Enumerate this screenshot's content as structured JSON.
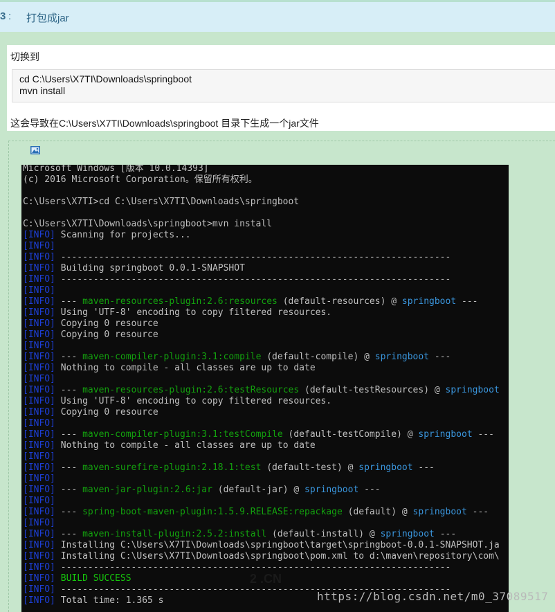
{
  "header": {
    "step_number": "3",
    "separator": ":",
    "title": "打包成jar"
  },
  "content": {
    "intro": "切换到",
    "code_lines": [
      "cd C:\\Users\\X7TI\\Downloads\\springboot",
      "mvn install"
    ],
    "result": "这会导致在C:\\Users\\X7TI\\Downloads\\springboot 目录下生成一个jar文件"
  },
  "editor": {
    "image_icon": "image-icon"
  },
  "terminal": {
    "lines": [
      [
        {
          "t": "Microsoft Windows [版本 10.0.14393]"
        }
      ],
      [
        {
          "t": "(c) 2016 Microsoft Corporation。保留所有权利。"
        }
      ],
      [],
      [
        {
          "t": "C:\\Users\\X7TI>cd C:\\Users\\X7TI\\Downloads\\springboot"
        }
      ],
      [],
      [
        {
          "t": "C:\\Users\\X7TI\\Downloads\\springboot>mvn install"
        }
      ],
      [
        {
          "t": "[INFO]",
          "c": "info"
        },
        {
          "t": " Scanning for projects..."
        }
      ],
      [
        {
          "t": "[INFO]",
          "c": "info"
        }
      ],
      [
        {
          "t": "[INFO]",
          "c": "info"
        },
        {
          "t": " ------------------------------------------------------------------------"
        }
      ],
      [
        {
          "t": "[INFO]",
          "c": "info"
        },
        {
          "t": " Building springboot 0.0.1-SNAPSHOT"
        }
      ],
      [
        {
          "t": "[INFO]",
          "c": "info"
        },
        {
          "t": " ------------------------------------------------------------------------"
        }
      ],
      [
        {
          "t": "[INFO]",
          "c": "info"
        }
      ],
      [
        {
          "t": "[INFO]",
          "c": "info"
        },
        {
          "t": " --- "
        },
        {
          "t": "maven-resources-plugin:2.6:resources",
          "c": "grn"
        },
        {
          "t": " (default-resources) @ "
        },
        {
          "t": "springboot",
          "c": "cyn"
        },
        {
          "t": " ---"
        }
      ],
      [
        {
          "t": "[INFO]",
          "c": "info"
        },
        {
          "t": " Using 'UTF-8' encoding to copy filtered resources."
        }
      ],
      [
        {
          "t": "[INFO]",
          "c": "info"
        },
        {
          "t": " Copying 0 resource"
        }
      ],
      [
        {
          "t": "[INFO]",
          "c": "info"
        },
        {
          "t": " Copying 0 resource"
        }
      ],
      [
        {
          "t": "[INFO]",
          "c": "info"
        }
      ],
      [
        {
          "t": "[INFO]",
          "c": "info"
        },
        {
          "t": " --- "
        },
        {
          "t": "maven-compiler-plugin:3.1:compile",
          "c": "grn"
        },
        {
          "t": " (default-compile) @ "
        },
        {
          "t": "springboot",
          "c": "cyn"
        },
        {
          "t": " ---"
        }
      ],
      [
        {
          "t": "[INFO]",
          "c": "info"
        },
        {
          "t": " Nothing to compile - all classes are up to date"
        }
      ],
      [
        {
          "t": "[INFO]",
          "c": "info"
        }
      ],
      [
        {
          "t": "[INFO]",
          "c": "info"
        },
        {
          "t": " --- "
        },
        {
          "t": "maven-resources-plugin:2.6:testResources",
          "c": "grn"
        },
        {
          "t": " (default-testResources) @ "
        },
        {
          "t": "springboot",
          "c": "cyn"
        }
      ],
      [
        {
          "t": "[INFO]",
          "c": "info"
        },
        {
          "t": " Using 'UTF-8' encoding to copy filtered resources."
        }
      ],
      [
        {
          "t": "[INFO]",
          "c": "info"
        },
        {
          "t": " Copying 0 resource"
        }
      ],
      [
        {
          "t": "[INFO]",
          "c": "info"
        }
      ],
      [
        {
          "t": "[INFO]",
          "c": "info"
        },
        {
          "t": " --- "
        },
        {
          "t": "maven-compiler-plugin:3.1:testCompile",
          "c": "grn"
        },
        {
          "t": " (default-testCompile) @ "
        },
        {
          "t": "springboot",
          "c": "cyn"
        },
        {
          "t": " ---"
        }
      ],
      [
        {
          "t": "[INFO]",
          "c": "info"
        },
        {
          "t": " Nothing to compile - all classes are up to date"
        }
      ],
      [
        {
          "t": "[INFO]",
          "c": "info"
        }
      ],
      [
        {
          "t": "[INFO]",
          "c": "info"
        },
        {
          "t": " --- "
        },
        {
          "t": "maven-surefire-plugin:2.18.1:test",
          "c": "grn"
        },
        {
          "t": " (default-test) @ "
        },
        {
          "t": "springboot",
          "c": "cyn"
        },
        {
          "t": " ---"
        }
      ],
      [
        {
          "t": "[INFO]",
          "c": "info"
        }
      ],
      [
        {
          "t": "[INFO]",
          "c": "info"
        },
        {
          "t": " --- "
        },
        {
          "t": "maven-jar-plugin:2.6:jar",
          "c": "grn"
        },
        {
          "t": " (default-jar) @ "
        },
        {
          "t": "springboot",
          "c": "cyn"
        },
        {
          "t": " ---"
        }
      ],
      [
        {
          "t": "[INFO]",
          "c": "info"
        }
      ],
      [
        {
          "t": "[INFO]",
          "c": "info"
        },
        {
          "t": " --- "
        },
        {
          "t": "spring-boot-maven-plugin:1.5.9.RELEASE:repackage",
          "c": "grn"
        },
        {
          "t": " (default) @ "
        },
        {
          "t": "springboot",
          "c": "cyn"
        },
        {
          "t": " ---"
        }
      ],
      [
        {
          "t": "[INFO]",
          "c": "info"
        }
      ],
      [
        {
          "t": "[INFO]",
          "c": "info"
        },
        {
          "t": " --- "
        },
        {
          "t": "maven-install-plugin:2.5.2:install",
          "c": "grn"
        },
        {
          "t": " (default-install) @ "
        },
        {
          "t": "springboot",
          "c": "cyn"
        },
        {
          "t": " ---"
        }
      ],
      [
        {
          "t": "[INFO]",
          "c": "info"
        },
        {
          "t": " Installing C:\\Users\\X7TI\\Downloads\\springboot\\target\\springboot-0.0.1-SNAPSHOT.ja"
        }
      ],
      [
        {
          "t": "[INFO]",
          "c": "info"
        },
        {
          "t": " Installing C:\\Users\\X7TI\\Downloads\\springboot\\pom.xml to d:\\maven\\repository\\com\\"
        }
      ],
      [
        {
          "t": "[INFO]",
          "c": "info"
        },
        {
          "t": " ------------------------------------------------------------------------"
        }
      ],
      [
        {
          "t": "[INFO]",
          "c": "info"
        },
        {
          "t": " BUILD SUCCESS",
          "c": "bsuc"
        }
      ],
      [
        {
          "t": "[INFO]",
          "c": "info"
        },
        {
          "t": " ------------------------------------------------------------------------"
        }
      ],
      [
        {
          "t": "[INFO]",
          "c": "info"
        },
        {
          "t": " Total time: 1.365 s"
        }
      ]
    ],
    "center_watermark": "2 .CN"
  },
  "watermark": "https://blog.csdn.net/m0_37089517",
  "colors": {
    "info": "#1d3fd6",
    "plugin": "#13a10e",
    "project": "#3a96dd",
    "success": "#16c60c",
    "page_bg": "#c7e6cc"
  }
}
